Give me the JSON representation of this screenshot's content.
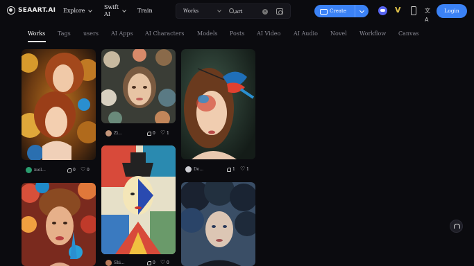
{
  "header": {
    "logo_text": "SEAART.AI",
    "nav": [
      {
        "label": "Explore",
        "has_menu": true
      },
      {
        "label": "Swift\nAI",
        "has_menu": true
      },
      {
        "label": "Train",
        "has_menu": false
      }
    ],
    "search": {
      "scope": "Works",
      "value": "art"
    },
    "create_label": "Create",
    "login_label": "Login"
  },
  "tabs": [
    "Works",
    "Tags",
    "users",
    "AI Apps",
    "AI Characters",
    "Models",
    "Posts",
    "AI Video",
    "AI Audio",
    "Novel",
    "Workflow",
    "Canvas"
  ],
  "active_tab": "Works",
  "cards": [
    {
      "author": "mel...",
      "likes": "0",
      "favorites": "0"
    },
    {
      "author": "Zi...",
      "likes": "0",
      "favorites": "1"
    },
    {
      "author": "De...",
      "likes": "1",
      "favorites": "1"
    },
    {
      "author": "",
      "likes": "",
      "favorites": ""
    },
    {
      "author": "Shi...",
      "likes": "0",
      "favorites": "0"
    },
    {
      "author": "",
      "likes": "",
      "favorites": ""
    }
  ],
  "colors": {
    "accent": "#3b82f6",
    "background": "#0b0b0f",
    "discord": "#5865f2"
  }
}
